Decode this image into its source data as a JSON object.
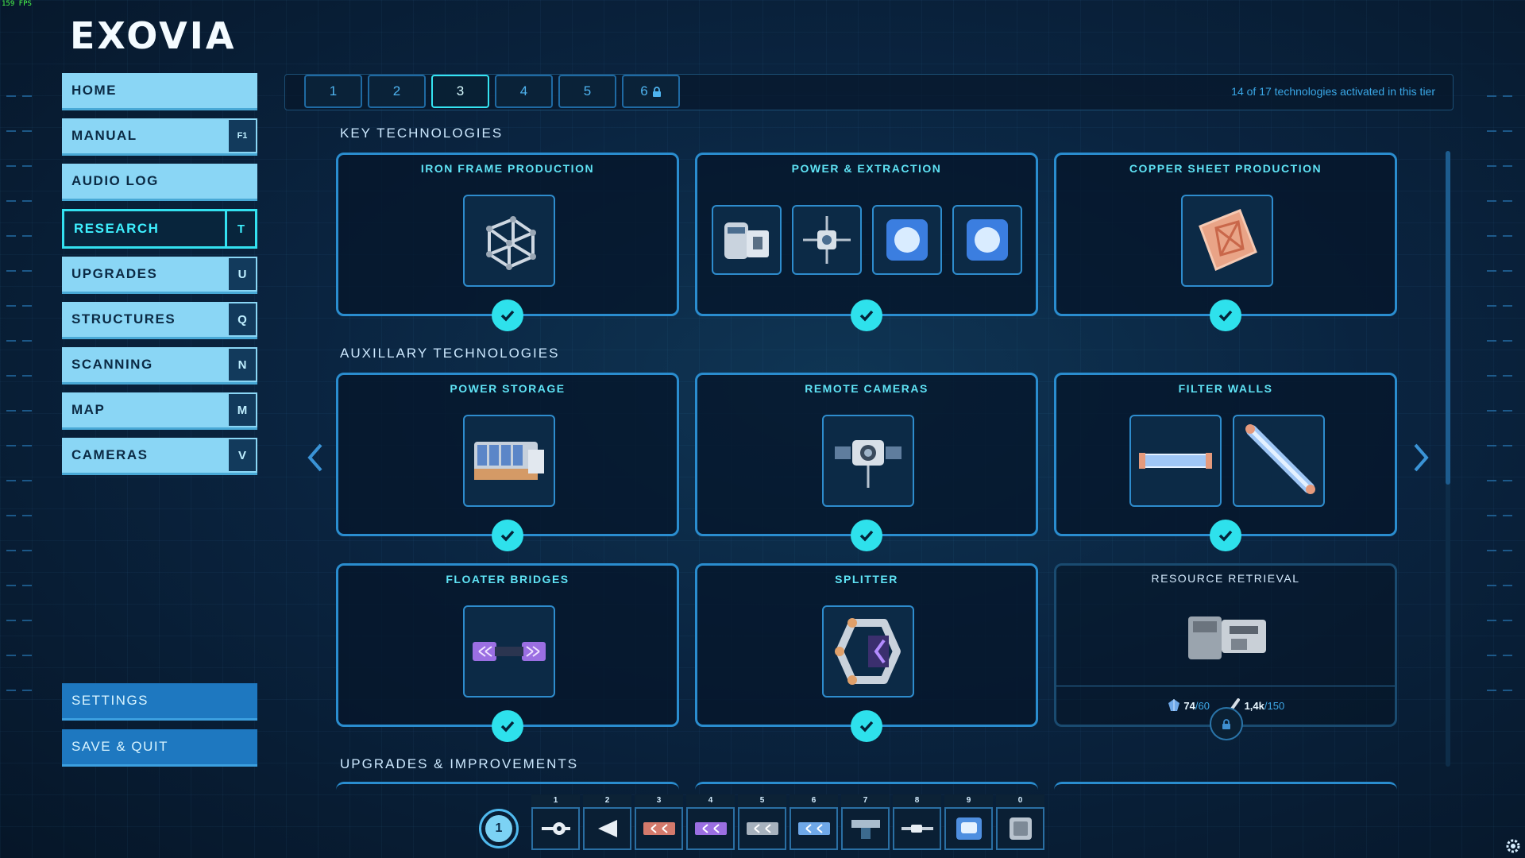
{
  "fps": "159 FPS",
  "logo": "EXOVIA",
  "nav": {
    "items": [
      {
        "label": "HOME",
        "key": ""
      },
      {
        "label": "MANUAL",
        "key": "F1"
      },
      {
        "label": "AUDIO LOG",
        "key": ""
      },
      {
        "label": "RESEARCH",
        "key": "T"
      },
      {
        "label": "UPGRADES",
        "key": "U"
      },
      {
        "label": "STRUCTURES",
        "key": "Q"
      },
      {
        "label": "SCANNING",
        "key": "N"
      },
      {
        "label": "MAP",
        "key": "M"
      },
      {
        "label": "CAMERAS",
        "key": "V"
      }
    ],
    "active": "RESEARCH",
    "settings": "SETTINGS",
    "save_quit": "SAVE & QUIT"
  },
  "tiers": {
    "tabs": [
      "1",
      "2",
      "3",
      "4",
      "5",
      "6"
    ],
    "active": "3",
    "locked": "6",
    "status": "14 of 17 technologies activated in this tier"
  },
  "sections": {
    "key": "KEY TECHNOLOGIES",
    "aux": "AUXILLARY TECHNOLOGIES",
    "upgrades": "UPGRADES & IMPROVEMENTS"
  },
  "cards": {
    "iron_frame": {
      "title": "IRON FRAME PRODUCTION",
      "activated": true
    },
    "power_extraction": {
      "title": "POWER & EXTRACTION",
      "activated": true
    },
    "copper_sheet": {
      "title": "COPPER SHEET PRODUCTION",
      "activated": true
    },
    "power_storage": {
      "title": "POWER STORAGE",
      "activated": true
    },
    "remote_cameras": {
      "title": "REMOTE CAMERAS",
      "activated": true
    },
    "filter_walls": {
      "title": "FILTER WALLS",
      "activated": true
    },
    "floater_bridges": {
      "title": "FLOATER BRIDGES",
      "activated": true
    },
    "splitter": {
      "title": "SPLITTER",
      "activated": true
    },
    "resource_retrieval": {
      "title": "RESOURCE RETRIEVAL",
      "activated": false,
      "cost": [
        {
          "icon": "crystal-resource-icon",
          "have": "74",
          "need": "/60"
        },
        {
          "icon": "rod-resource-icon",
          "have": "1,4k",
          "need": "/150"
        }
      ]
    }
  },
  "hotbar": {
    "main": "1",
    "slots": [
      {
        "num": "1",
        "icon": "pipe-connector-icon"
      },
      {
        "num": "2",
        "icon": "arrow-ramp-icon"
      },
      {
        "num": "3",
        "icon": "red-conveyor-icon"
      },
      {
        "num": "4",
        "icon": "purple-conveyor-icon"
      },
      {
        "num": "5",
        "icon": "grey-conveyor-icon"
      },
      {
        "num": "6",
        "icon": "blue-conveyor-icon"
      },
      {
        "num": "7",
        "icon": "camera-tile-icon"
      },
      {
        "num": "8",
        "icon": "rod-tool-icon"
      },
      {
        "num": "9",
        "icon": "lamp-block-icon"
      },
      {
        "num": "0",
        "icon": "frame-block-icon"
      }
    ]
  },
  "colors": {
    "accent": "#33e1f0",
    "nav_bg": "#8ad6f5",
    "card_border": "#2a8dcf",
    "button_blue": "#1e78c0"
  }
}
